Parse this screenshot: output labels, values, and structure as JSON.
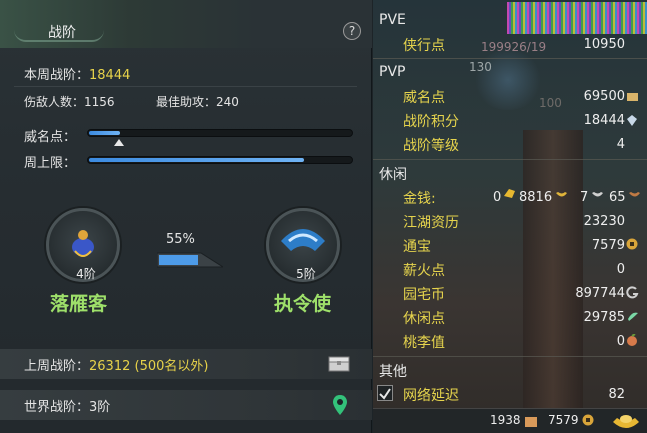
{
  "left": {
    "title": "战阶",
    "help": "?",
    "week_rank_label": "本周战阶：",
    "week_rank_value": "18444",
    "kills_label": "伤敌人数：",
    "kills_value": "1156",
    "assists_label": "最佳助攻：",
    "assists_value": "240",
    "prestige_label": "威名点：",
    "prestige_progress": 0.12,
    "cap_label": "周上限：",
    "cap_progress": 0.82,
    "current_rank": {
      "level": "4阶",
      "name": "落雁客"
    },
    "next_rank": {
      "level": "5阶",
      "name": "执令使"
    },
    "upgrade_percent_text": "55%",
    "upgrade_progress": 0.55,
    "last_week_label": "上周战阶：",
    "last_week_value": "26312 (500名以外)",
    "world_rank_label": "世界战阶：",
    "world_rank_value": "3阶"
  },
  "right": {
    "pve_header": "PVE",
    "pvp_header": "PVP",
    "leisure_header": "休闲",
    "other_header": "其他",
    "bg_overlay": [
      "199926/19",
      "130",
      "100"
    ],
    "rows": {
      "xiaxing": {
        "label": "侠行点",
        "value": "10950"
      },
      "weiming": {
        "label": "威名点",
        "value": "69500"
      },
      "zhanjie_score": {
        "label": "战阶积分",
        "value": "18444"
      },
      "zhanjie_level": {
        "label": "战阶等级",
        "value": "4"
      },
      "money": {
        "label": "金钱:",
        "gold_prefix": "0",
        "gold": "8816",
        "silver": "7",
        "copper": "65"
      },
      "jianghu": {
        "label": "江湖资历",
        "value": "23230"
      },
      "tongbao": {
        "label": "通宝",
        "value": "7579"
      },
      "xinhuo": {
        "label": "薪火点",
        "value": "0"
      },
      "yuanzhai": {
        "label": "园宅币",
        "value": "897744"
      },
      "xiuxian": {
        "label": "休闲点",
        "value": "29785"
      },
      "taoli": {
        "label": "桃李值",
        "value": "0"
      },
      "latency": {
        "label": "网络延迟",
        "value": "82"
      }
    },
    "footer": {
      "a": "1938",
      "b": "7579"
    }
  },
  "colors": {
    "accent_yellow": "#e8d34a",
    "rank_green": "#9ee06a",
    "bar_blue": "#4d9be8"
  }
}
